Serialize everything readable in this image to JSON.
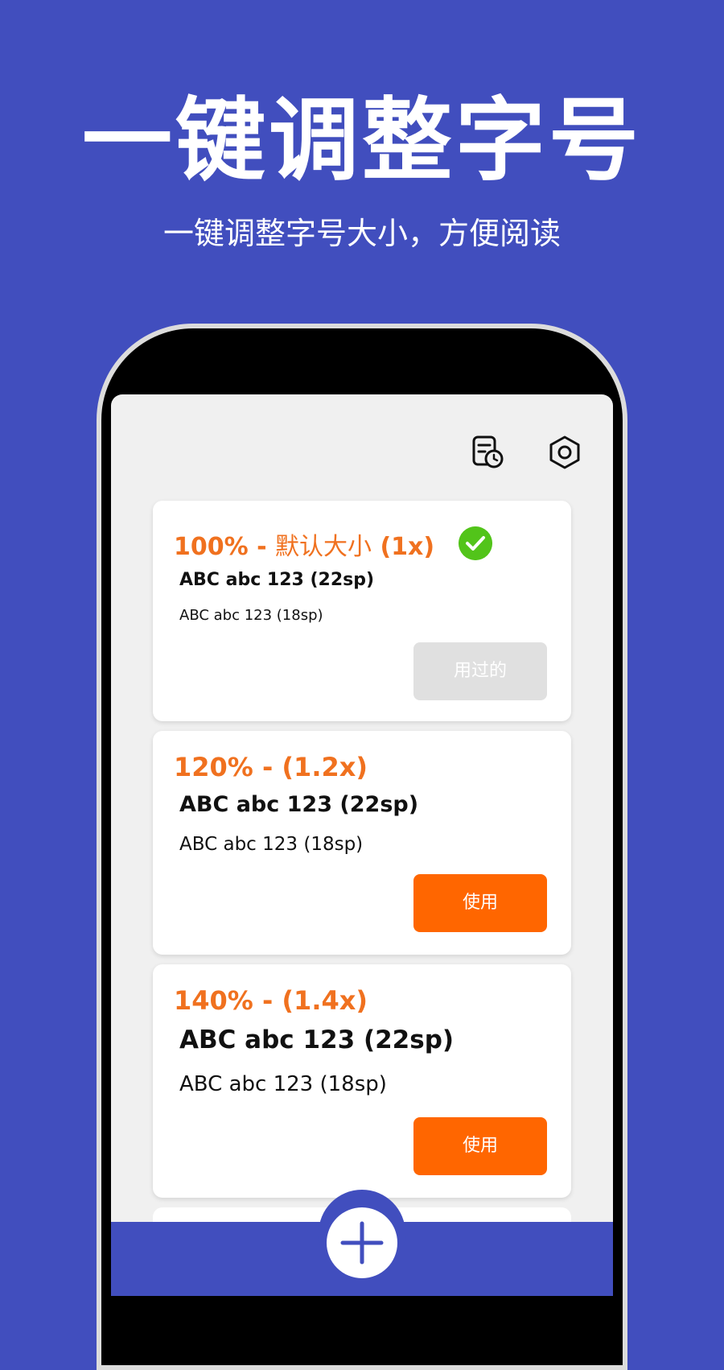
{
  "promo": {
    "headline": "一键调整字号",
    "subheadline": "一键调整字号大小，方便阅读"
  },
  "app_bar": {
    "icons": [
      "document-clock-icon",
      "hexagon-settings-icon"
    ]
  },
  "options": [
    {
      "title_percent": "100% - ",
      "title_name": "默认大小",
      "title_factor": " (1x)",
      "sample_large": "ABC abc 123 (22sp)",
      "sample_small": "ABC abc 123 (18sp)",
      "button_label": "用过的",
      "selected": true
    },
    {
      "title_percent": "120% - ",
      "title_name": "",
      "title_factor": "(1.2x)",
      "sample_large": "ABC abc 123 (22sp)",
      "sample_small": "ABC abc 123 (18sp)",
      "button_label": "使用",
      "selected": false
    },
    {
      "title_percent": "140% - ",
      "title_name": "",
      "title_factor": "(1.4x)",
      "sample_large": "ABC abc 123 (22sp)",
      "sample_small": "ABC abc 123 (18sp)",
      "button_label": "使用",
      "selected": false
    }
  ],
  "fab": {
    "icon": "plus-icon"
  },
  "colors": {
    "background": "#414EBE",
    "accent": "#F0711F",
    "button": "#FF6600",
    "button_disabled": "#E0E0E0",
    "check": "#52C41A",
    "screen": "#F0F0F0"
  }
}
